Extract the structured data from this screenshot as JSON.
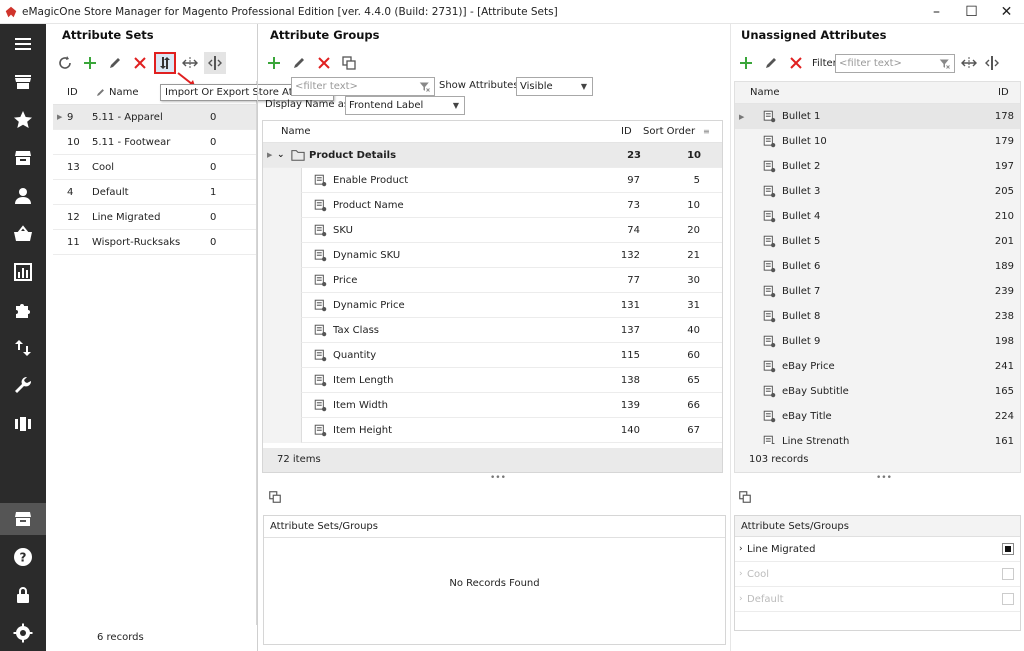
{
  "window": {
    "title": "eMagicOne Store Manager for Magento Professional Edition [ver. 4.4.0 (Build: 2731)] - [Attribute Sets]",
    "minimize": "–",
    "maximize": "☐",
    "close": "✕"
  },
  "colors": {
    "accent_red": "#e02020",
    "add_green": "#3aa63a",
    "nav_bg": "#2b2b2b"
  },
  "nav": {
    "items": [
      "menu-icon",
      "store-icon",
      "star-icon",
      "box-icon",
      "user-icon",
      "basket-icon",
      "chart-icon",
      "puzzle-icon",
      "transfer-icon",
      "wrench-icon",
      "columns-icon"
    ],
    "bottom": [
      "storage-icon",
      "help-icon",
      "lock-icon",
      "settings-icon"
    ]
  },
  "attribute_sets": {
    "title": "Attribute Sets",
    "columns": {
      "id": "ID",
      "name": "Name"
    },
    "rows": [
      {
        "id": "9",
        "name": "5.11 - Apparel",
        "count": "0"
      },
      {
        "id": "10",
        "name": "5.11 - Footwear",
        "count": "0"
      },
      {
        "id": "13",
        "name": "Cool",
        "count": "0"
      },
      {
        "id": "4",
        "name": "Default",
        "count": "1"
      },
      {
        "id": "12",
        "name": "Line Migrated",
        "count": "0"
      },
      {
        "id": "11",
        "name": "Wisport-Rucksaks",
        "count": "0"
      }
    ],
    "footer": "6 records",
    "tooltip": "Import Or Export Store Attribute Sets"
  },
  "attribute_groups": {
    "title": "Attribute Groups",
    "filter_placeholder": "<filter text>",
    "show_attributes_label": "Show Attributes",
    "show_attributes_value": "Visible",
    "display_name_label": "Display Name as",
    "display_name_value": "Frontend Label",
    "columns": {
      "name": "Name",
      "id": "ID",
      "sort": "Sort Order"
    },
    "group": {
      "name": "Product Details",
      "id": "23",
      "sort": "10"
    },
    "rows": [
      {
        "name": "Enable Product",
        "id": "97",
        "sort": "5"
      },
      {
        "name": "Product Name",
        "id": "73",
        "sort": "10"
      },
      {
        "name": "SKU",
        "id": "74",
        "sort": "20"
      },
      {
        "name": "Dynamic SKU",
        "id": "132",
        "sort": "21"
      },
      {
        "name": "Price",
        "id": "77",
        "sort": "30"
      },
      {
        "name": "Dynamic Price",
        "id": "131",
        "sort": "31"
      },
      {
        "name": "Tax Class",
        "id": "137",
        "sort": "40"
      },
      {
        "name": "Quantity",
        "id": "115",
        "sort": "60"
      },
      {
        "name": "Item Length",
        "id": "138",
        "sort": "65"
      },
      {
        "name": "Item Width",
        "id": "139",
        "sort": "66"
      },
      {
        "name": "Item Height",
        "id": "140",
        "sort": "67"
      }
    ],
    "footer": "72 items",
    "sets_groups_title": "Attribute Sets/Groups",
    "no_records": "No Records Found"
  },
  "unassigned": {
    "title": "Unassigned Attributes",
    "filter_label": "Filter",
    "filter_placeholder": "<filter text>",
    "columns": {
      "name": "Name",
      "id": "ID"
    },
    "rows": [
      {
        "name": "Bullet 1",
        "id": "178"
      },
      {
        "name": "Bullet 10",
        "id": "179"
      },
      {
        "name": "Bullet 2",
        "id": "197"
      },
      {
        "name": "Bullet 3",
        "id": "205"
      },
      {
        "name": "Bullet 4",
        "id": "210"
      },
      {
        "name": "Bullet 5",
        "id": "201"
      },
      {
        "name": "Bullet 6",
        "id": "189"
      },
      {
        "name": "Bullet 7",
        "id": "239"
      },
      {
        "name": "Bullet 8",
        "id": "238"
      },
      {
        "name": "Bullet 9",
        "id": "198"
      },
      {
        "name": "eBay Price",
        "id": "241"
      },
      {
        "name": "eBay Subtitle",
        "id": "165"
      },
      {
        "name": "eBay Title",
        "id": "224"
      },
      {
        "name": "Line Strength",
        "id": "161"
      }
    ],
    "footer": "103 records",
    "sets_groups_title": "Attribute Sets/Groups",
    "sets": [
      {
        "name": "Line Migrated",
        "checked": true,
        "enabled": true
      },
      {
        "name": "Cool",
        "checked": false,
        "enabled": false
      },
      {
        "name": "Default",
        "checked": false,
        "enabled": false
      }
    ]
  }
}
